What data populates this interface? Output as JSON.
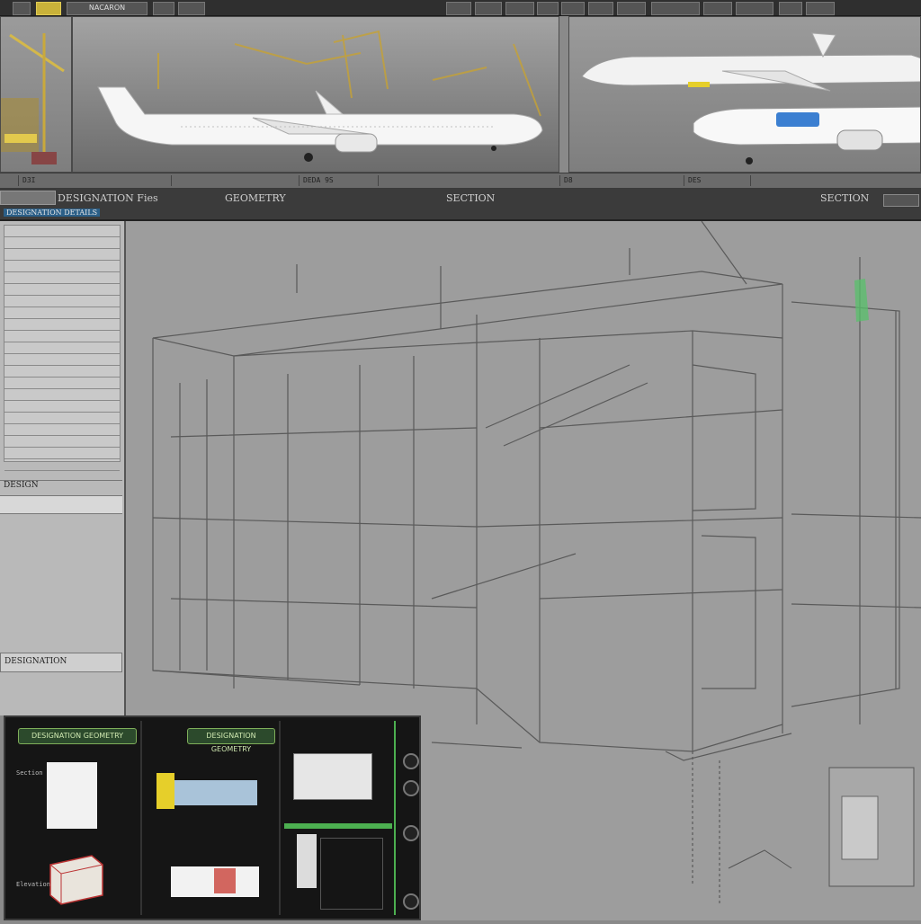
{
  "toolbar": {
    "left_items": [
      "",
      "",
      "",
      "NACARON",
      "",
      ""
    ],
    "right_items": [
      "",
      "",
      "",
      "",
      "",
      "",
      "",
      "",
      "",
      ""
    ]
  },
  "ruler": {
    "labels": [
      "D3I",
      "DEDA 9S",
      "D8",
      "DES"
    ]
  },
  "header": {
    "tab_left": "DESIGNATION Fies",
    "sub_left": "DESIGNATION DETAILS",
    "geometry": "GEOMETRY",
    "section": "SECTION",
    "right_title": "SECTION"
  },
  "sidebar": {
    "footer_label": "DESIGN",
    "bottom_label": "DESIGNATION",
    "rows": 22
  },
  "panel": {
    "btn1": "DESIGNATION GEOMETRY",
    "btn2": "DESIGNATION GEOMETRY",
    "caption1": "Section",
    "caption2": "Elevation"
  },
  "colors": {
    "accent_yellow": "#e6cf2a",
    "accent_blue": "#3b7fd1",
    "accent_green": "#58c26b"
  }
}
